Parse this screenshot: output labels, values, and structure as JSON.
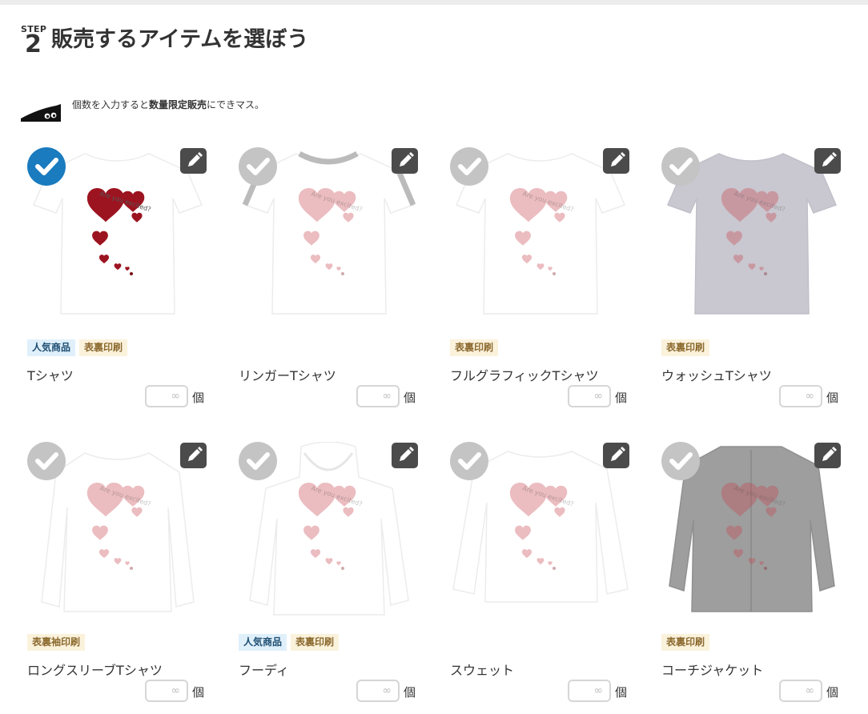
{
  "header": {
    "step_label": "STEP",
    "step_number": "2",
    "title": "販売するアイテムを選ぼう"
  },
  "note": {
    "prefix": "個数を入力すると",
    "bold": "数量限定販売",
    "suffix": "にできマス。"
  },
  "print_text": "Are you excited?",
  "colors": {
    "selected_check": "#1a7bbf",
    "unselected_check": "#c4c4c4",
    "edit_button": "#4b4b4b",
    "badge_popular_bg": "#e0f0fb",
    "badge_print_bg": "#fbf2dc",
    "heart": "#a01822"
  },
  "icons": {
    "check": "check-icon",
    "edit": "pencil-icon"
  },
  "items": [
    {
      "name": "Tシャツ",
      "badges": [
        "人気商品",
        "表裏印刷"
      ],
      "selected": true,
      "qty_placeholder": "∞",
      "unit": "個"
    },
    {
      "name": "リンガーTシャツ",
      "badges": [],
      "selected": false,
      "qty_placeholder": "∞",
      "unit": "個"
    },
    {
      "name": "フルグラフィックTシャツ",
      "badges": [
        "表裏印刷"
      ],
      "selected": false,
      "qty_placeholder": "∞",
      "unit": "個"
    },
    {
      "name": "ウォッシュTシャツ",
      "badges": [
        "表裏印刷"
      ],
      "selected": false,
      "qty_placeholder": "∞",
      "unit": "個"
    },
    {
      "name": "ロングスリーブTシャツ",
      "badges": [
        "表裏袖印刷"
      ],
      "selected": false,
      "qty_placeholder": "∞",
      "unit": "個"
    },
    {
      "name": "フーディ",
      "badges": [
        "人気商品",
        "表裏印刷"
      ],
      "selected": false,
      "qty_placeholder": "∞",
      "unit": "個"
    },
    {
      "name": "スウェット",
      "badges": [],
      "selected": false,
      "qty_placeholder": "∞",
      "unit": "個"
    },
    {
      "name": "コーチジャケット",
      "badges": [
        "表裏印刷"
      ],
      "selected": false,
      "qty_placeholder": "∞",
      "unit": "個"
    }
  ]
}
